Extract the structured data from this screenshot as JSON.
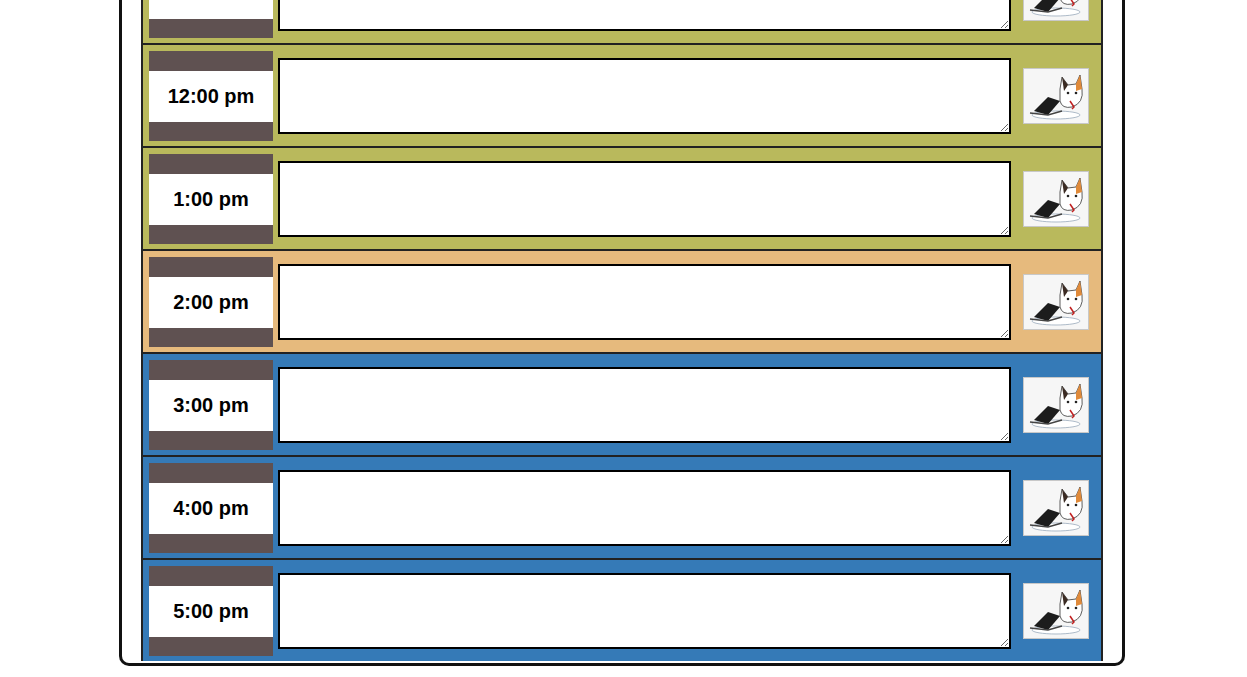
{
  "rows": [
    {
      "time": "",
      "state": "past"
    },
    {
      "time": "12:00 pm",
      "state": "past"
    },
    {
      "time": "1:00 pm",
      "state": "past"
    },
    {
      "time": "2:00 pm",
      "state": "present"
    },
    {
      "time": "3:00 pm",
      "state": "future"
    },
    {
      "time": "4:00 pm",
      "state": "future"
    },
    {
      "time": "5:00 pm",
      "state": "future"
    }
  ]
}
